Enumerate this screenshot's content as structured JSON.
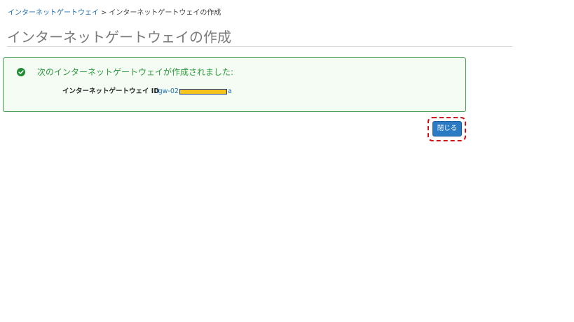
{
  "breadcrumb": {
    "parent_label": "インターネットゲートウェイ",
    "separator": ">",
    "current_label": "インターネットゲートウェイの作成"
  },
  "page": {
    "title": "インターネットゲートウェイの作成"
  },
  "success_panel": {
    "icon": "check-circle-icon",
    "message": "次のインターネットゲートウェイが作成されました:",
    "id_label": "インターネットゲートウェイ ID",
    "id_prefix": "igw-02",
    "id_suffix": "a"
  },
  "actions": {
    "close_label": "閉じる"
  },
  "colors": {
    "success_green": "#2e9a3e",
    "link_blue": "#1f6fb2",
    "button_blue": "#2a7ac4",
    "highlight_red": "#d40f17",
    "redaction_yellow": "#f6c41a"
  }
}
